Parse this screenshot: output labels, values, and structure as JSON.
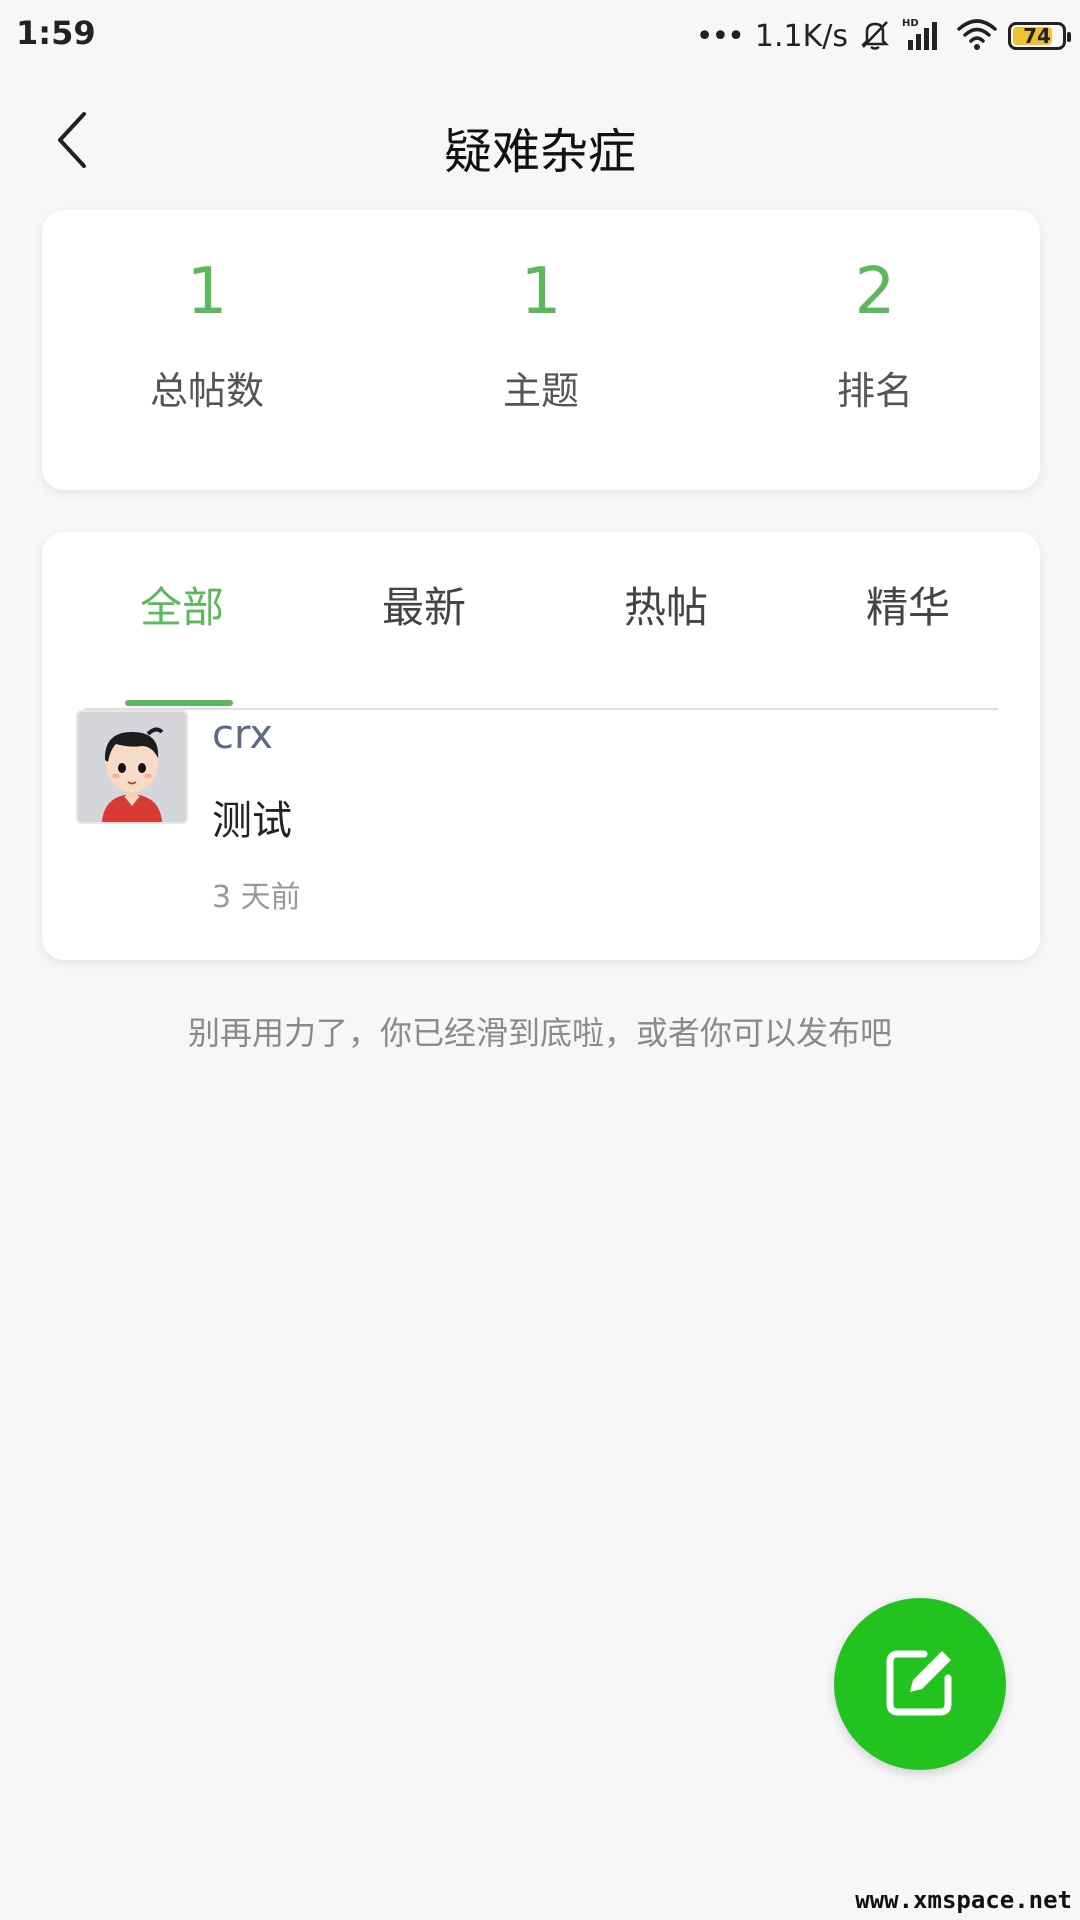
{
  "status_bar": {
    "time": "1:59",
    "dots": "•••",
    "net_speed": "1.1K/s",
    "battery_level": "74",
    "battery_color": "#f0c232",
    "icons": [
      "mute-bell-icon",
      "hd-signal-icon",
      "wifi-icon",
      "battery-icon"
    ]
  },
  "header": {
    "title": "疑难杂症",
    "back_icon": "chevron-left-icon"
  },
  "stats": [
    {
      "value": "1",
      "label": "总帖数"
    },
    {
      "value": "1",
      "label": "主题"
    },
    {
      "value": "2",
      "label": "排名"
    }
  ],
  "tabs": [
    {
      "label": "全部",
      "active": true
    },
    {
      "label": "最新",
      "active": false
    },
    {
      "label": "热帖",
      "active": false
    },
    {
      "label": "精华",
      "active": false
    }
  ],
  "posts": [
    {
      "author": "crx",
      "title": "测试",
      "time": "3 天前"
    }
  ],
  "end_hint": "别再用力了，你已经滑到底啦，或者你可以发布吧",
  "fab": {
    "icon": "edit-icon"
  },
  "watermark": "www.xmspace.net",
  "colors": {
    "accent": "#5cb85c",
    "fab": "#22c31f",
    "author": "#5c6a86"
  }
}
